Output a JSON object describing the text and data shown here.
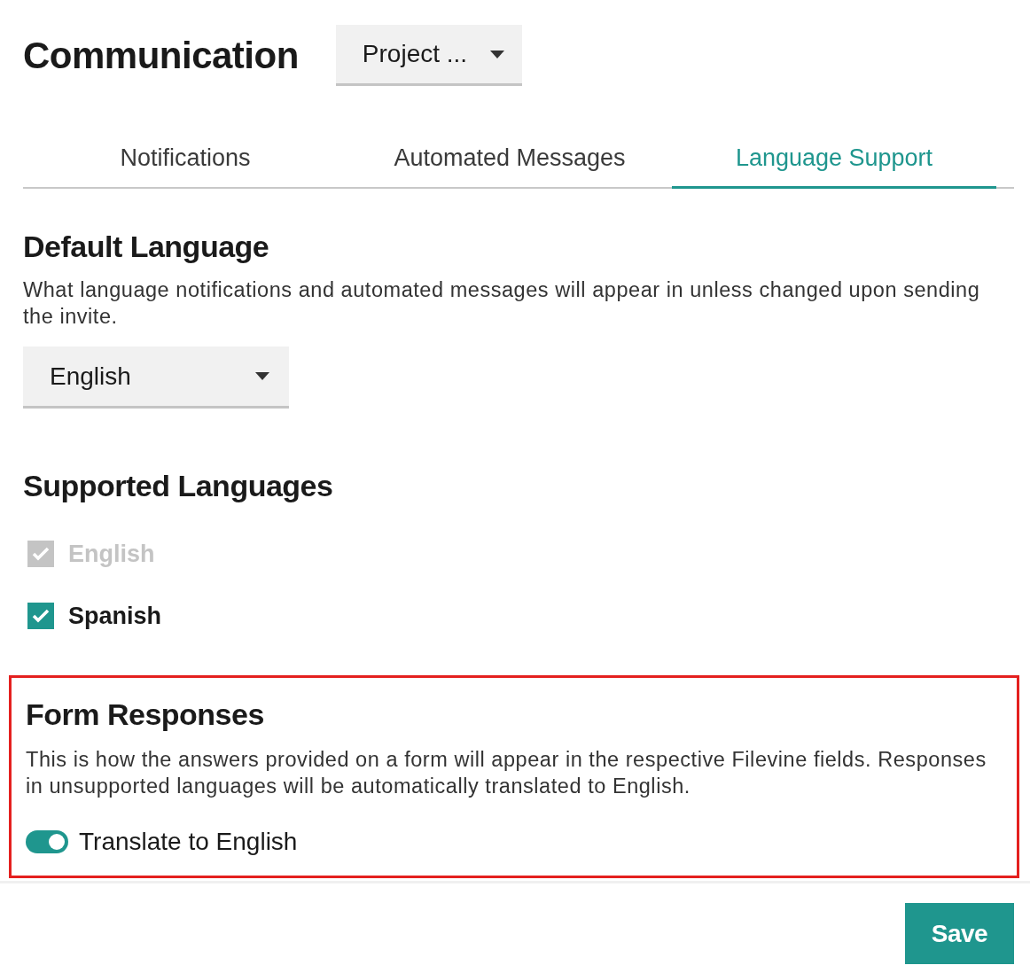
{
  "page": {
    "title": "Communication"
  },
  "project_select": {
    "value": "Project ..."
  },
  "tabs": [
    {
      "label": "Notifications",
      "selected": false
    },
    {
      "label": "Automated Messages",
      "selected": false
    },
    {
      "label": "Language Support",
      "selected": true
    }
  ],
  "default_language": {
    "heading": "Default Language",
    "description": "What language notifications and automated messages will appear in unless changed upon sending the invite.",
    "select_value": "English"
  },
  "supported_languages": {
    "heading": "Supported Languages",
    "items": [
      {
        "label": "English",
        "checked": true,
        "disabled": true
      },
      {
        "label": "Spanish",
        "checked": true,
        "disabled": false
      }
    ]
  },
  "form_responses": {
    "heading": "Form Responses",
    "highlighted": true,
    "description": "This is how the answers provided on a form will appear in the respective Filevine fields. Responses in unsupported languages will be automatically translated to English.",
    "toggle": {
      "label": "Translate to English",
      "on": true
    }
  },
  "buttons": [
    {
      "label": "Save"
    }
  ]
}
